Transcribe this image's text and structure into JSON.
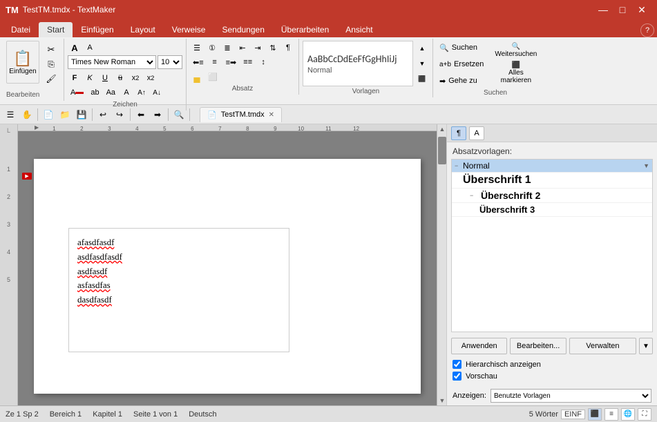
{
  "titlebar": {
    "title": "TestTM.tmdx - TextMaker",
    "app_icon": "TM",
    "min_btn": "—",
    "max_btn": "□",
    "close_btn": "✕"
  },
  "ribbon_tabs": [
    {
      "label": "Datei",
      "active": false
    },
    {
      "label": "Start",
      "active": true
    },
    {
      "label": "Einfügen",
      "active": false
    },
    {
      "label": "Layout",
      "active": false
    },
    {
      "label": "Verweise",
      "active": false
    },
    {
      "label": "Sendungen",
      "active": false
    },
    {
      "label": "Überarbeiten",
      "active": false
    },
    {
      "label": "Ansicht",
      "active": false
    }
  ],
  "ribbon": {
    "clipboard_group": {
      "label": "Bearbeiten",
      "paste_label": "Einfügen",
      "paste_icon": "📋",
      "cut_label": "✂",
      "copy_label": "⎘",
      "format_label": "🖌"
    },
    "font_group": {
      "label": "Zeichen",
      "font_name": "Times New Roman",
      "font_size": "10",
      "bold": "F",
      "italic": "K",
      "underline": "U",
      "strikethrough": "ü",
      "sub": "x₂",
      "sup": "x²",
      "grow": "A↑",
      "shrink": "A↓",
      "color_btn": "A",
      "highlight": "ab",
      "caps": "Aa"
    },
    "para_group": {
      "label": "Absatz",
      "list_btn": "≡",
      "num_list": "①",
      "indent_dec": "⇤",
      "indent_inc": "⇥",
      "align_left": "≡",
      "align_center": "≡",
      "align_right": "≡",
      "justify": "≡",
      "line_space": "↕",
      "shading": "🎨",
      "borders": "⬜"
    },
    "styles_group": {
      "label": "Vorlagen",
      "preview_text": "AaBbCcDdEeFfGgHhIiJj",
      "style_name": "Normal",
      "dropdown_arrow": "▼"
    },
    "search_group": {
      "label": "Suchen",
      "search_btn": "Suchen",
      "search_icon": "🔍",
      "replace_btn": "a+b Ersetzen",
      "replace_icon": "🔄",
      "goto_btn": "→ Gehe zu",
      "goto_icon": "→",
      "weitersuchen_btn": "Weitersuchen",
      "alles_markieren_label": "Alles\nmarkieren"
    }
  },
  "toolbar": {
    "buttons": [
      "☰",
      "✋",
      "📄",
      "📁",
      "💾",
      "↩",
      "↪",
      "⬅",
      "➡",
      "🔍"
    ],
    "doc_tab_label": "TestTM.tmdx",
    "doc_tab_close": "✕"
  },
  "document": {
    "text_lines": [
      "afasdfasdf",
      "asdfasdfasdf",
      "asdfasdf",
      "asfasdfas",
      "dasdfasdf"
    ],
    "font": "Times New Roman",
    "font_size": "13px"
  },
  "right_panel": {
    "panel_title": "Absatzvorlagen:",
    "tool_btn1": "¶",
    "tool_btn2": "A",
    "styles": [
      {
        "label": "Normal",
        "level": 0,
        "expand": "−",
        "class": "normal",
        "selected": true
      },
      {
        "label": "Überschrift 1",
        "level": 1,
        "expand": "",
        "class": "heading1",
        "selected": false
      },
      {
        "label": "Überschrift 2",
        "level": 2,
        "expand": "",
        "class": "heading2",
        "selected": false
      },
      {
        "label": "Überschrift 3",
        "level": 3,
        "expand": "",
        "class": "heading3",
        "selected": false
      }
    ],
    "btn_anwenden": "Anwenden",
    "btn_bearbeiten": "Bearbeiten...",
    "btn_verwalten": "Verwalten",
    "btn_verwalten_arrow": "▼",
    "checkbox_hierarchisch": "Hierarchisch anzeigen",
    "checkbox_vorschau": "Vorschau",
    "show_label": "Anzeigen:",
    "show_value": "Benutzte Vorlagen"
  },
  "statusbar": {
    "ze": "Ze 1 Sp 2",
    "bereich": "Bereich 1",
    "kapitel": "Kapitel 1",
    "seite": "Seite 1 von 1",
    "sprache": "Deutsch",
    "woerter": "5 Wörter",
    "einf": "EINF"
  },
  "help_btn": "?"
}
